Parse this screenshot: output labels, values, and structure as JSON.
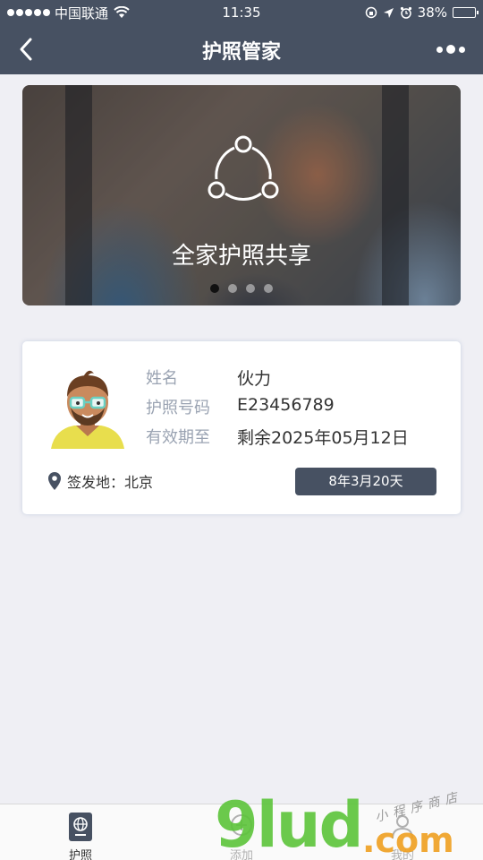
{
  "status_bar": {
    "carrier": "中国联通",
    "time": "11:35",
    "battery": "38%",
    "battery_level": 0.38
  },
  "nav": {
    "title": "护照管家"
  },
  "banner": {
    "caption": "全家护照共享",
    "slides_total": 4,
    "active_slide": 1
  },
  "passport": {
    "name_label": "姓名",
    "name_value": "伙力",
    "number_label": "护照号码",
    "number_value": "E23456789",
    "expiry_label": "有效期至",
    "expiry_value": "剩余2025年05月12日",
    "issue_place": "签发地：北京",
    "remaining": "8年3月20天"
  },
  "tabs": [
    {
      "label": "护照",
      "icon": "passport-icon",
      "active": true
    },
    {
      "label": "添加",
      "icon": "add-icon",
      "active": false
    },
    {
      "label": "我的",
      "icon": "user-icon",
      "active": false
    }
  ],
  "watermark": {
    "brand": "9lud",
    "suffix": ".com",
    "tagline": "小程序商店"
  },
  "colors": {
    "primary": "#475162",
    "background": "#efeff4",
    "label_gray": "#9aa3b2"
  }
}
